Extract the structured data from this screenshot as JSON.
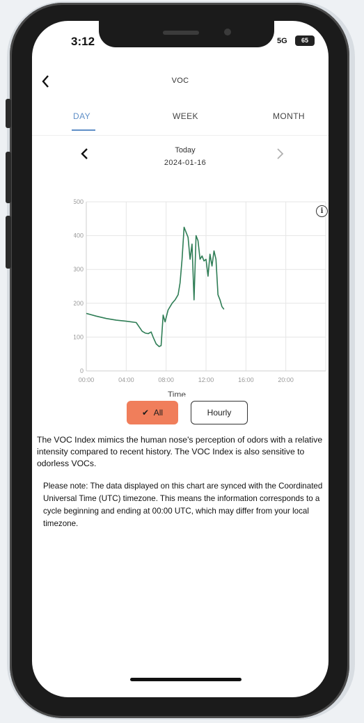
{
  "status": {
    "time": "3:12",
    "network": "5G",
    "battery": "65"
  },
  "header": {
    "title": "VOC",
    "back_icon": "chevron-left-icon"
  },
  "tabs": [
    {
      "label": "DAY",
      "active": true
    },
    {
      "label": "WEEK",
      "active": false
    },
    {
      "label": "MONTH",
      "active": false
    }
  ],
  "date_nav": {
    "label": "Today",
    "date": "2024-01-16",
    "prev_icon": "chevron-left-icon",
    "next_icon": "chevron-right-icon"
  },
  "info_icon": "info-icon",
  "chart_data": {
    "type": "line",
    "title": "",
    "xlabel": "Time",
    "ylabel": "",
    "xlim": [
      0,
      24
    ],
    "ylim": [
      0,
      500
    ],
    "xticks": [
      0,
      4,
      8,
      12,
      16,
      20
    ],
    "xtick_labels": [
      "00:00",
      "04:00",
      "08:00",
      "12:00",
      "16:00",
      "20:00"
    ],
    "yticks": [
      0,
      100,
      200,
      300,
      400,
      500
    ],
    "ytick_labels": [
      "0",
      "100",
      "200",
      "300",
      "400",
      "500"
    ],
    "grid": true,
    "series": [
      {
        "color": "#2e7d55",
        "points": [
          [
            0.0,
            170
          ],
          [
            1.0,
            162
          ],
          [
            2.0,
            155
          ],
          [
            3.0,
            150
          ],
          [
            4.0,
            147
          ],
          [
            5.0,
            143
          ],
          [
            5.3,
            130
          ],
          [
            5.6,
            117
          ],
          [
            5.9,
            112
          ],
          [
            6.2,
            110
          ],
          [
            6.5,
            115
          ],
          [
            6.7,
            100
          ],
          [
            7.0,
            80
          ],
          [
            7.3,
            72
          ],
          [
            7.5,
            75
          ],
          [
            7.7,
            165
          ],
          [
            7.9,
            145
          ],
          [
            8.2,
            180
          ],
          [
            8.6,
            200
          ],
          [
            8.9,
            210
          ],
          [
            9.2,
            225
          ],
          [
            9.4,
            260
          ],
          [
            9.6,
            330
          ],
          [
            9.8,
            425
          ],
          [
            10.0,
            410
          ],
          [
            10.2,
            395
          ],
          [
            10.4,
            330
          ],
          [
            10.6,
            375
          ],
          [
            10.8,
            210
          ],
          [
            11.0,
            400
          ],
          [
            11.2,
            385
          ],
          [
            11.4,
            330
          ],
          [
            11.6,
            340
          ],
          [
            11.8,
            325
          ],
          [
            12.0,
            330
          ],
          [
            12.2,
            280
          ],
          [
            12.4,
            345
          ],
          [
            12.6,
            310
          ],
          [
            12.8,
            355
          ],
          [
            13.0,
            330
          ],
          [
            13.2,
            225
          ],
          [
            13.4,
            210
          ],
          [
            13.6,
            190
          ],
          [
            13.8,
            182
          ]
        ]
      }
    ]
  },
  "toggles": {
    "all_label": "All",
    "all_icon": "checkmark-icon",
    "hourly_label": "Hourly"
  },
  "description": "The VOC Index mimics the human nose's perception of odors with a relative intensity compared to recent history. The VOC Index is also sensitive to odorless VOCs.",
  "note": "Please note: The data displayed on this chart are synced with the Coordinated Universal Time (UTC) timezone. This means the information corresponds to a cycle beginning and ending at 00:00 UTC, which may differ from your local timezone."
}
